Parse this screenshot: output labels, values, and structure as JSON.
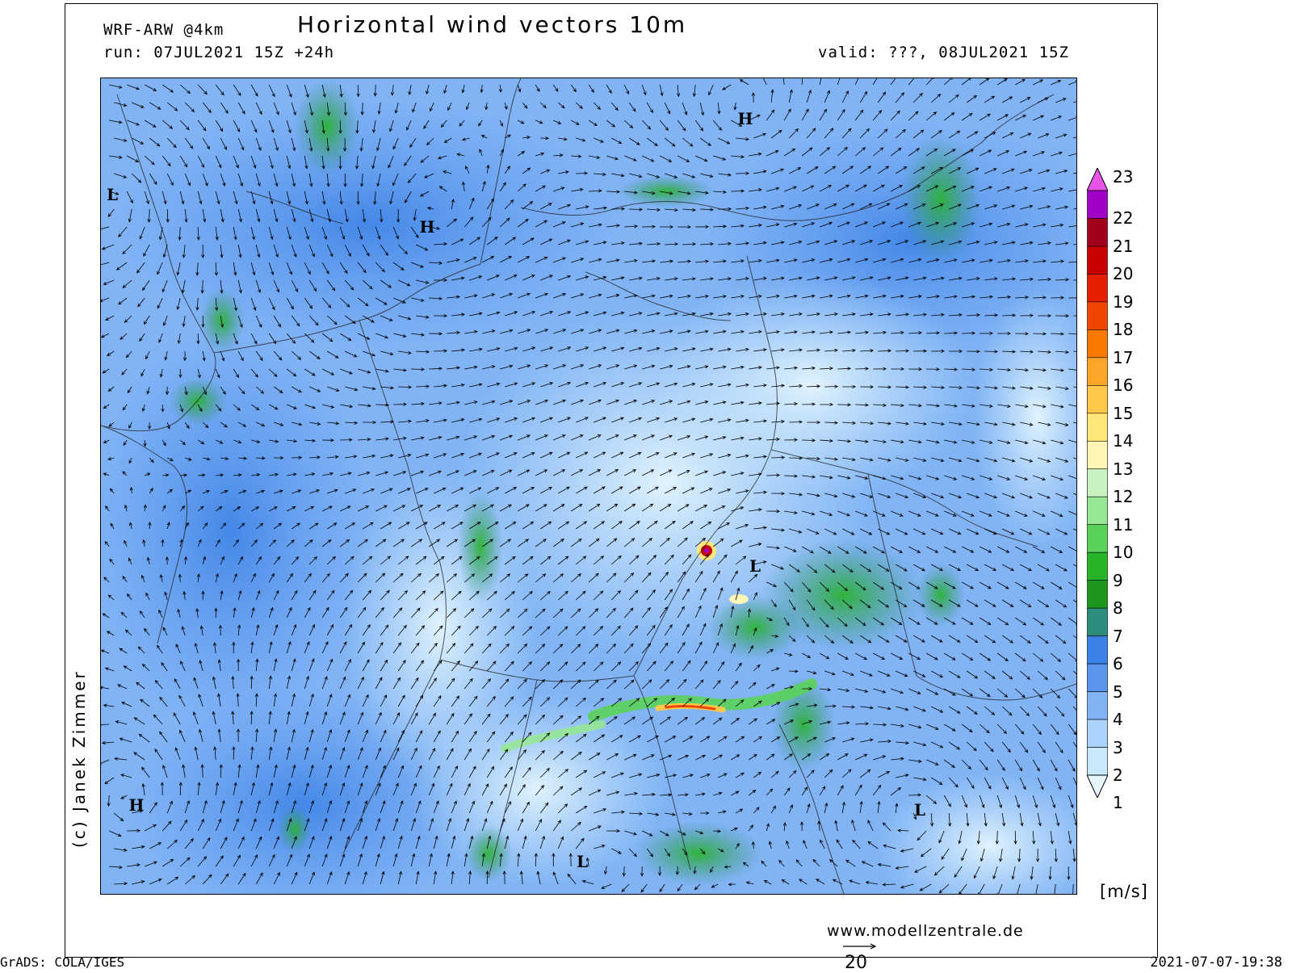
{
  "header": {
    "model": "WRF-ARW @4km",
    "run": "run: 07JUL2021 15Z +24h",
    "title": "Horizontal wind vectors 10m",
    "valid": "valid: ???, 08JUL2021 15Z"
  },
  "footer": {
    "copyright": "(c) Janek Zimmer",
    "website": "www.modellzentrale.de",
    "software": "GrADS: COLA/IGES",
    "timestamp": "2021-07-07-19:38",
    "reference_vector_label": "20"
  },
  "legend": {
    "units": "[m/s]",
    "levels": [
      {
        "label": "23",
        "color": "#e655e6"
      },
      {
        "label": "22",
        "color": "#a000c8"
      },
      {
        "label": "21",
        "color": "#a0001e"
      },
      {
        "label": "20",
        "color": "#c80000"
      },
      {
        "label": "19",
        "color": "#e61e00"
      },
      {
        "label": "18",
        "color": "#f04600"
      },
      {
        "label": "17",
        "color": "#fa7800"
      },
      {
        "label": "16",
        "color": "#fca528"
      },
      {
        "label": "15",
        "color": "#ffc84a"
      },
      {
        "label": "14",
        "color": "#ffe678"
      },
      {
        "label": "13",
        "color": "#fff5b4"
      },
      {
        "label": "12",
        "color": "#c8f0c0"
      },
      {
        "label": "11",
        "color": "#96e696"
      },
      {
        "label": "10",
        "color": "#5ad25a"
      },
      {
        "label": "9",
        "color": "#28b428"
      },
      {
        "label": "8",
        "color": "#1e961e"
      },
      {
        "label": "7",
        "color": "#2e8c7d"
      },
      {
        "label": "6",
        "color": "#3c82e6"
      },
      {
        "label": "5",
        "color": "#5a96ee"
      },
      {
        "label": "4",
        "color": "#82b4f5"
      },
      {
        "label": "3",
        "color": "#aad2fa"
      },
      {
        "label": "2",
        "color": "#c8e8fc"
      },
      {
        "label": "1",
        "color": "#e6f6fe"
      }
    ]
  },
  "pressure_centers": [
    {
      "label": "H",
      "kind": "high"
    },
    {
      "label": "H",
      "kind": "high"
    },
    {
      "label": "H",
      "kind": "high"
    },
    {
      "label": "L",
      "kind": "low"
    },
    {
      "label": "L",
      "kind": "low"
    },
    {
      "label": "L",
      "kind": "low"
    },
    {
      "label": "L",
      "kind": "low"
    }
  ]
}
